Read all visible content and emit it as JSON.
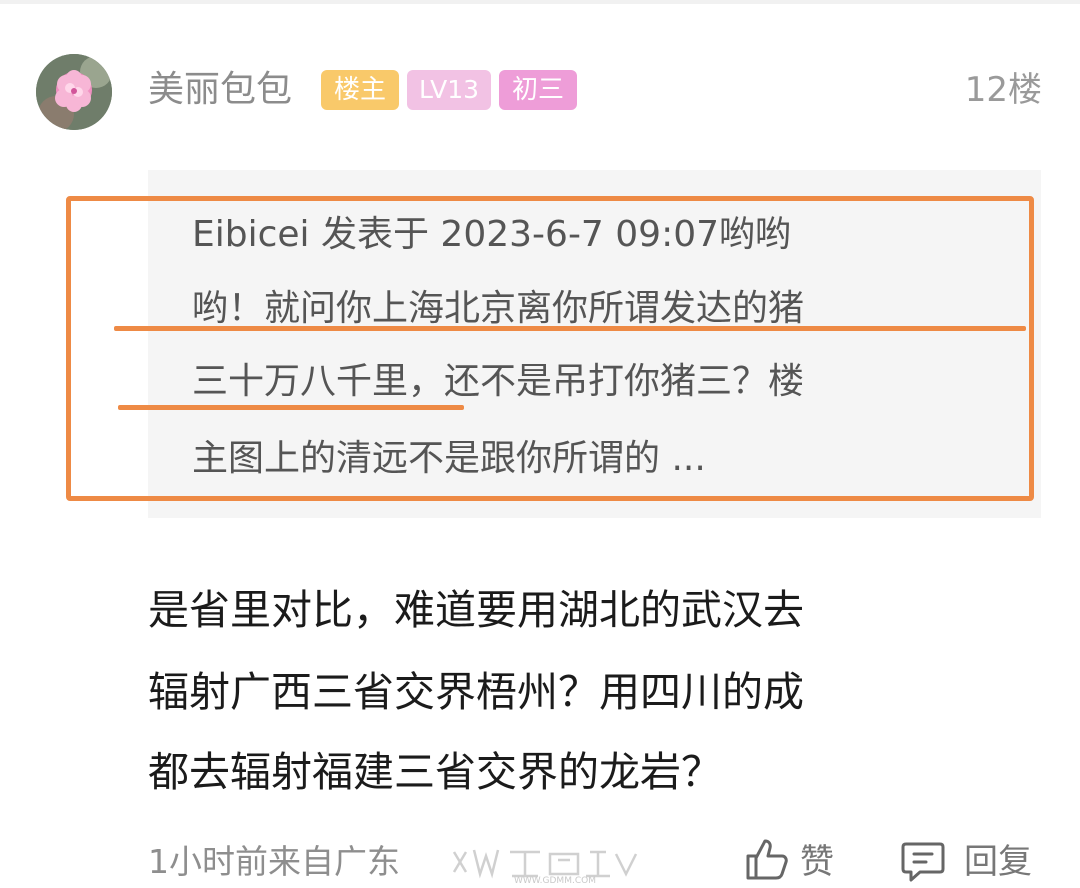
{
  "post": {
    "username": "美丽包包",
    "badges": {
      "owner": "楼主",
      "level": "LV13",
      "grade": "初三"
    },
    "floor": "12楼",
    "quote": {
      "lines": [
        "Eibicei 发表于 2023-6-7 09:07哟哟",
        "哟！就问你上海北京离你所谓发达的猪",
        "三十万八千里，还不是吊打你猪三？楼",
        "主图上的清远不是跟你所谓的 ..."
      ]
    },
    "body_lines": [
      "是省里对比，难道要用湖北的武汉去",
      "辐射广西三省交界梧州？用四川的成",
      "都去辐射福建三省交界的龙岩？"
    ],
    "meta": "1小时前来自广东",
    "actions": {
      "like": "赞",
      "reply": "回复"
    },
    "watermark_text": "WWW.GDMM.COM"
  },
  "colors": {
    "highlight": "#ee8a45",
    "badge_owner": "#f9c96a",
    "badge_level": "#f2c2e4",
    "badge_grade": "#ee9dd8"
  },
  "icons": {
    "like": "thumbs-up-icon",
    "reply": "comment-icon",
    "avatar": "pink-flower-avatar"
  }
}
